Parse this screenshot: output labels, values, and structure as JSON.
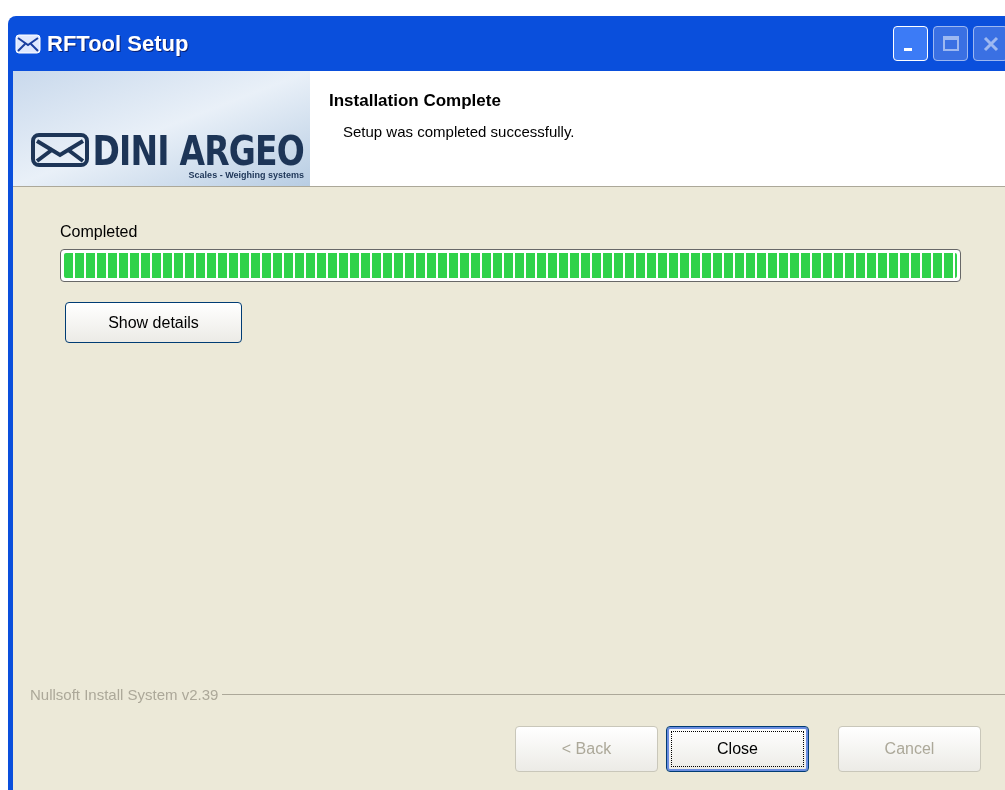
{
  "window": {
    "title": "RFTool Setup",
    "controls": [
      {
        "kind": "minimize",
        "disabled": false
      },
      {
        "kind": "maximize",
        "disabled": true
      },
      {
        "kind": "close",
        "disabled": true
      }
    ]
  },
  "header": {
    "logo": {
      "brand": "DINI ARGEO",
      "tagline": "Scales - Weighing systems"
    },
    "title": "Installation Complete",
    "subtitle": "Setup was completed successfully."
  },
  "progress": {
    "label": "Completed",
    "level": 1
  },
  "details_button": {
    "label": "Show details"
  },
  "branding": "Nullsoft Install System v2.39",
  "buttons": [
    {
      "label": "< Back",
      "disabled": true,
      "default": false
    },
    {
      "label": "Close",
      "disabled": false,
      "default": true
    },
    {
      "label": "Cancel",
      "disabled": true,
      "default": false
    }
  ]
}
